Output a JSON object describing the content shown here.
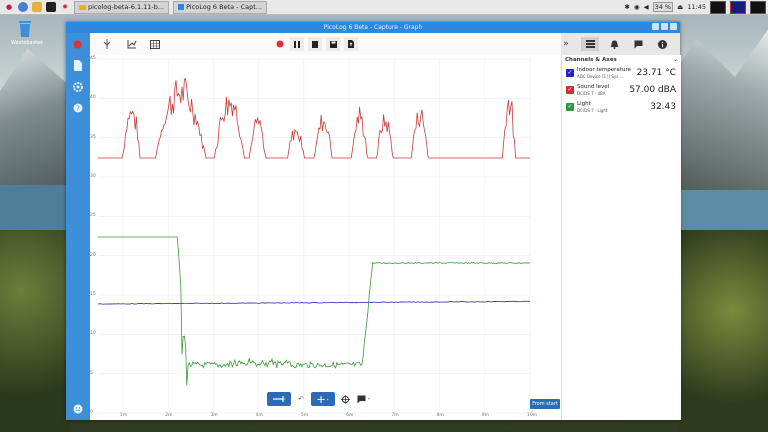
{
  "taskbar": {
    "tasks": [
      "picolog-beta-6.1.11-b...",
      "PicoLog 6 Beta - Capt..."
    ],
    "clock": "11:45",
    "volume_label": "34 %"
  },
  "desktop": {
    "trash_label": "Wastebasket"
  },
  "window": {
    "title": "PicoLog 6 Beta - Capture - Graph"
  },
  "right_panel": {
    "header": "Channels & Axes",
    "channels": [
      {
        "name": "Indoor temperature",
        "sub": "ADC Device [1] / Sys ...",
        "value": "23.71 °C",
        "color": "#2222c8"
      },
      {
        "name": "Sound level",
        "sub": "DC/DS 7 · dBA",
        "value": "57.00 dBA",
        "color": "#d23030"
      },
      {
        "name": "Light",
        "sub": "DC/DS 7 · Light",
        "value": "32.43",
        "color": "#2a9a3a"
      }
    ]
  },
  "plot": {
    "from_start_label": "From start",
    "y_ticks": [
      "45",
      "40",
      "35",
      "30",
      "25",
      "20",
      "15",
      "10",
      "5",
      "0"
    ],
    "x_ticks": [
      "1m",
      "2m",
      "3m",
      "4m",
      "5m",
      "6m",
      "7m",
      "8m",
      "9m",
      "10m"
    ]
  },
  "colors": {
    "sidebar": "#3c8fd8",
    "titlebar": "#2d88e0",
    "sound": "#c83c3c",
    "light": "#3a9a3a",
    "temp": "#4040b0"
  },
  "icons": {
    "record": "record-icon",
    "pause": "pause-icon",
    "stop": "stop-icon",
    "save": "save-icon",
    "export": "export-icon"
  }
}
